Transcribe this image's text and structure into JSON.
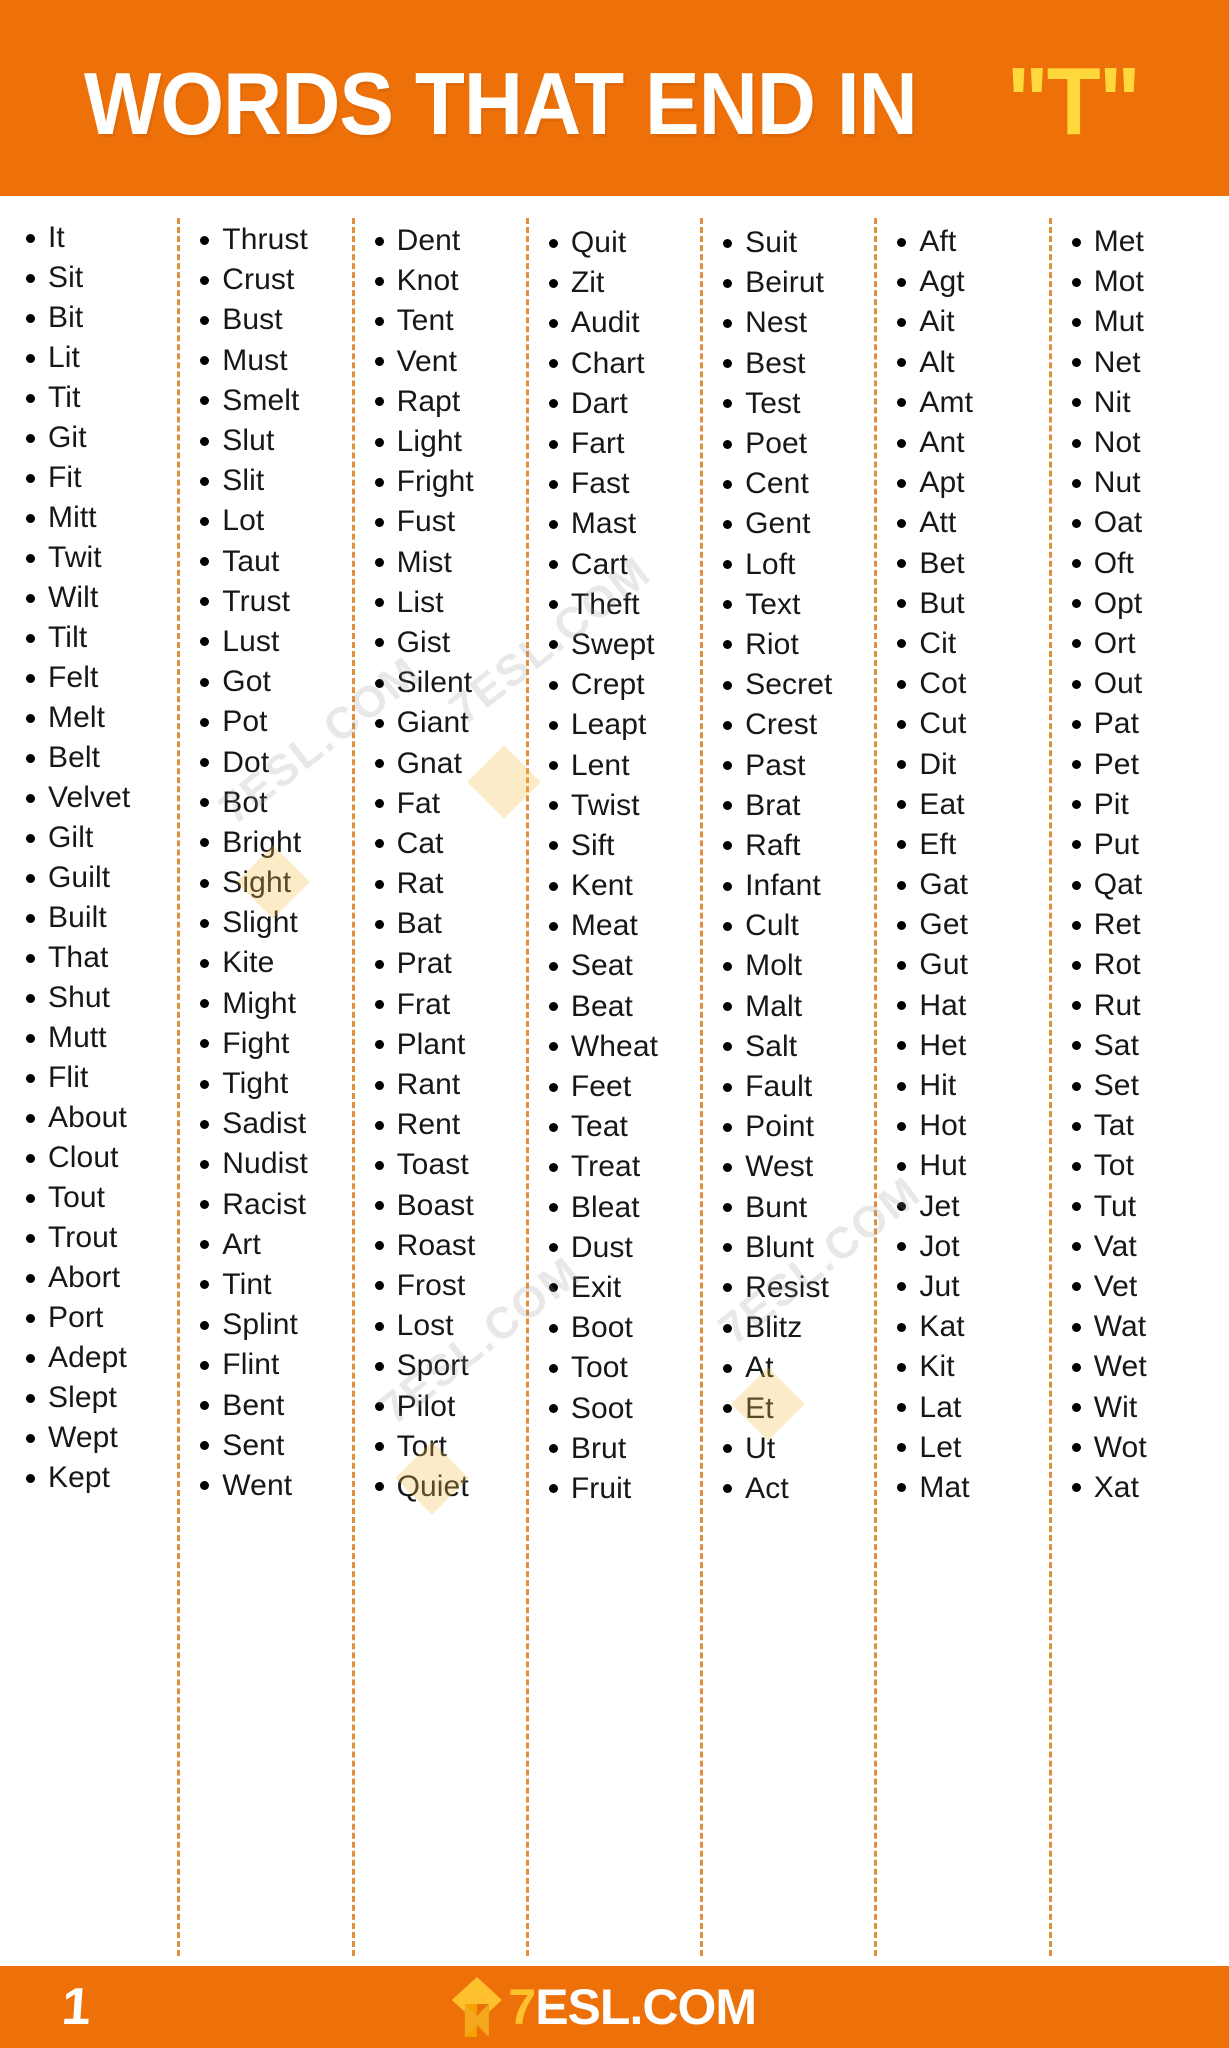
{
  "header": {
    "title": "WORDS THAT END IN",
    "highlight": "\"T\"",
    "bg_color": "#ee7008",
    "title_color": "#ffffff",
    "highlight_color": "#ffd93b"
  },
  "footer": {
    "page_number": "1",
    "brand_seven": "7",
    "brand_rest": "ESL.COM",
    "bg_color": "#ee7008"
  },
  "watermarks": [
    "7ESL.COM",
    "7ESL.COM",
    "7ESL.COM",
    "7ESL.COM"
  ],
  "columns": [
    {
      "id": "col-1",
      "words": [
        "It",
        "Sit",
        "Bit",
        "Lit",
        "Tit",
        "Git",
        "Fit",
        "Mitt",
        "Twit",
        "Wilt",
        "Tilt",
        "Felt",
        "Melt",
        "Belt",
        "Velvet",
        "Gilt",
        "Guilt",
        "Built",
        "That",
        "Shut",
        "Mutt",
        "Flit",
        "About",
        "Clout",
        "Tout",
        "Trout",
        "Abort",
        "Port",
        "Adept",
        "Slept",
        "Wept",
        "Kept"
      ]
    },
    {
      "id": "col-2",
      "words": [
        "Thrust",
        "Crust",
        "Bust",
        "Must",
        "Smelt",
        "Slut",
        "Slit",
        "Lot",
        "Taut",
        "Trust",
        "Lust",
        "Got",
        "Pot",
        "Dot",
        "Bot",
        "Bright",
        "Sight",
        "Slight",
        "Kite",
        "Might",
        "Fight",
        "Tight",
        "Sadist",
        "Nudist",
        "Racist",
        "Art",
        "Tint",
        "Splint",
        "Flint",
        "Bent",
        "Sent",
        "Went"
      ]
    },
    {
      "id": "col-3",
      "words": [
        "Dent",
        "Knot",
        "Tent",
        "Vent",
        "Rapt",
        "Light",
        "Fright",
        "Fust",
        "Mist",
        "List",
        "Gist",
        "Silent",
        "Giant",
        "Gnat",
        "Fat",
        "Cat",
        "Rat",
        "Bat",
        "Prat",
        "Frat",
        "Plant",
        "Rant",
        "Rent",
        "Toast",
        "Boast",
        "Roast",
        "Frost",
        "Lost",
        "Sport",
        "Pilot",
        "Tort",
        "Quiet"
      ]
    },
    {
      "id": "col-4",
      "words": [
        "Quit",
        "Zit",
        "Audit",
        "Chart",
        "Dart",
        "Fart",
        "Fast",
        "Mast",
        "Cart",
        "Theft",
        "Swept",
        "Crept",
        "Leapt",
        "Lent",
        "Twist",
        "Sift",
        "Kent",
        "Meat",
        "Seat",
        "Beat",
        "Wheat",
        "Feet",
        "Teat",
        "Treat",
        "Bleat",
        "Dust",
        "Exit",
        "Boot",
        "Toot",
        "Soot",
        "Brut",
        "Fruit"
      ]
    },
    {
      "id": "col-5",
      "words": [
        "Suit",
        "Beirut",
        "Nest",
        "Best",
        "Test",
        "Poet",
        "Cent",
        "Gent",
        "Loft",
        "Text",
        "Riot",
        "Secret",
        "Crest",
        "Past",
        "Brat",
        "Raft",
        "Infant",
        "Cult",
        "Molt",
        "Malt",
        "Salt",
        "Fault",
        "Point",
        "West",
        "Bunt",
        "Blunt",
        "Resist",
        "Blitz",
        "At",
        "Et",
        "Ut",
        "Act"
      ]
    },
    {
      "id": "col-6",
      "words": [
        "Aft",
        "Agt",
        "Ait",
        "Alt",
        "Amt",
        "Ant",
        "Apt",
        "Att",
        "Bet",
        "But",
        "Cit",
        "Cot",
        "Cut",
        "Dit",
        "Eat",
        "Eft",
        "Gat",
        "Get",
        "Gut",
        "Hat",
        "Het",
        "Hit",
        "Hot",
        "Hut",
        "Jet",
        "Jot",
        "Jut",
        "Kat",
        "Kit",
        "Lat",
        "Let",
        "Mat"
      ]
    },
    {
      "id": "col-7",
      "words": [
        "Met",
        "Mot",
        "Mut",
        "Net",
        "Nit",
        "Not",
        "Nut",
        "Oat",
        "Oft",
        "Opt",
        "Ort",
        "Out",
        "Pat",
        "Pet",
        "Pit",
        "Put",
        "Qat",
        "Ret",
        "Rot",
        "Rut",
        "Sat",
        "Set",
        "Tat",
        "Tot",
        "Tut",
        "Vat",
        "Vet",
        "Wat",
        "Wet",
        "Wit",
        "Wot",
        "Xat"
      ]
    }
  ]
}
